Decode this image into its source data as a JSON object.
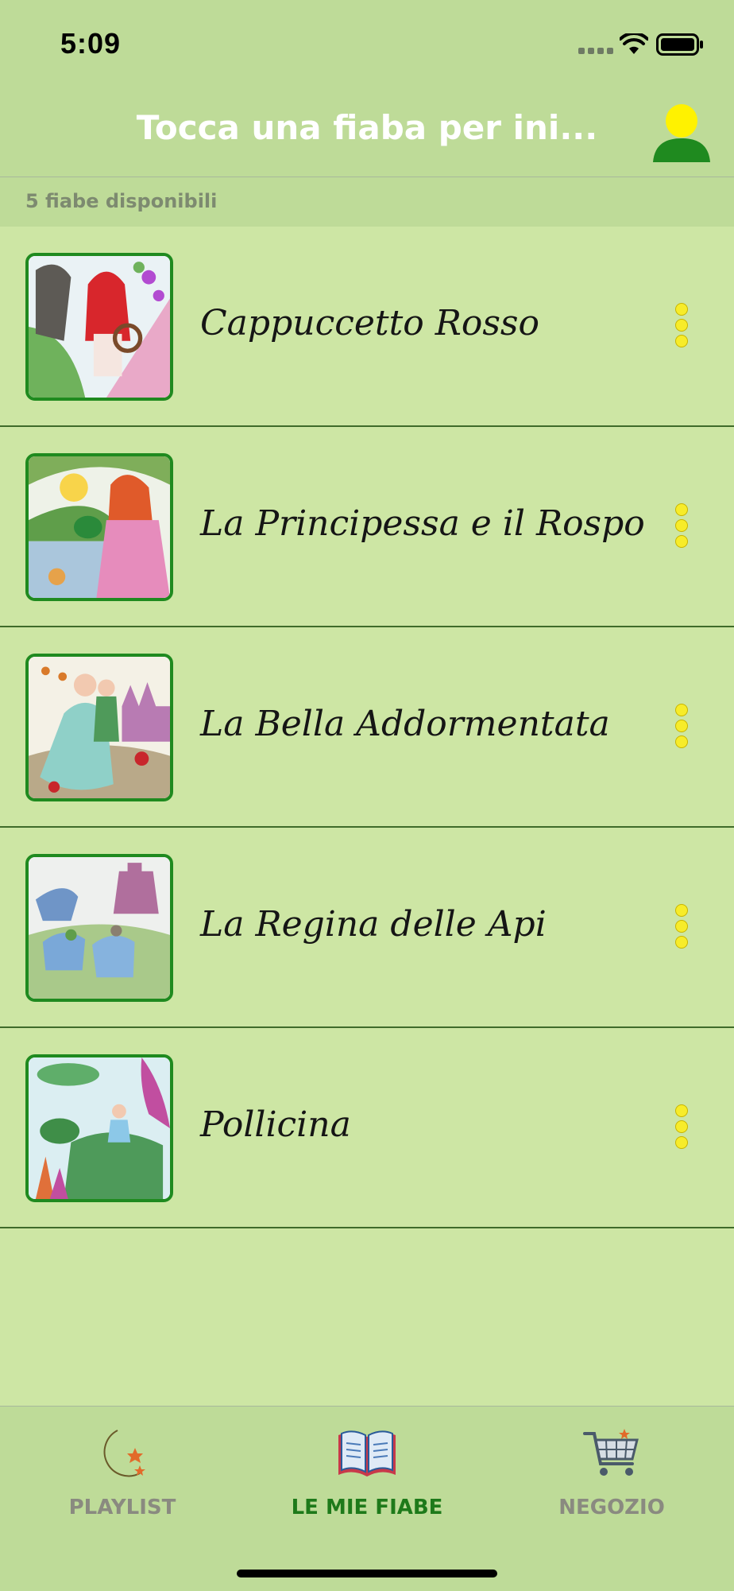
{
  "status_bar": {
    "time": "5:09"
  },
  "header": {
    "title": "Tocca una fiaba per ini..."
  },
  "section": {
    "label": "5 fiabe disponibili"
  },
  "stories": [
    {
      "title": "Cappuccetto Rosso",
      "thumb_icon": "red-riding-hood-illustration"
    },
    {
      "title": "La Principessa e il Rospo",
      "thumb_icon": "princess-frog-illustration"
    },
    {
      "title": "La Bella Addormentata",
      "thumb_icon": "sleeping-beauty-illustration"
    },
    {
      "title": "La Regina delle Api",
      "thumb_icon": "queen-bees-illustration"
    },
    {
      "title": "Pollicina",
      "thumb_icon": "thumbelina-illustration"
    }
  ],
  "tabs": [
    {
      "label": "PLAYLIST",
      "icon": "moon-stars-icon",
      "active": false
    },
    {
      "label": "LE MIE FIABE",
      "icon": "open-book-icon",
      "active": true
    },
    {
      "label": "NEGOZIO",
      "icon": "shopping-cart-icon",
      "active": false
    }
  ],
  "colors": {
    "background": "#cde6a4",
    "bar": "#bedb98",
    "accent": "#1e7a1a",
    "more_dots": "#f7ec2a"
  }
}
